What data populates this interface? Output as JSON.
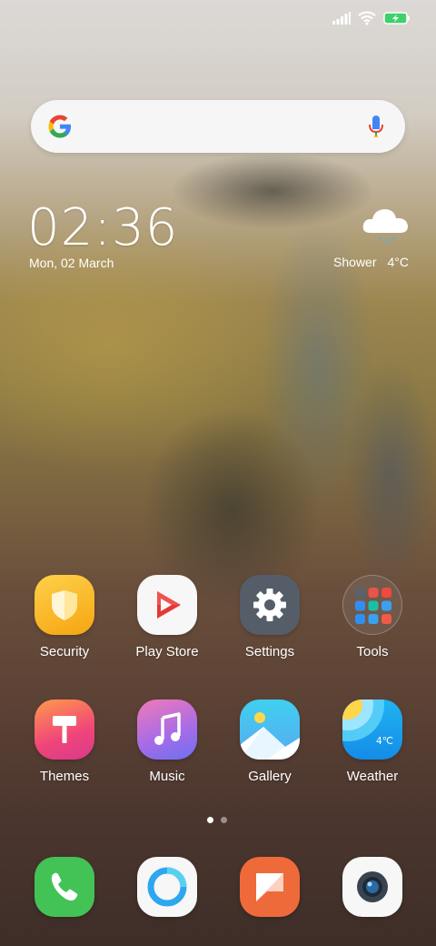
{
  "status_bar": {
    "icons": [
      "signal-icon",
      "wifi-icon",
      "battery-charging-icon"
    ]
  },
  "search": {
    "icon_left": "google-logo",
    "icon_right": "mic-icon",
    "placeholder": ""
  },
  "clock_widget": {
    "time": "02:36",
    "date": "Mon, 02 March"
  },
  "weather_widget": {
    "icon": "cloud-rain-icon",
    "condition": "Shower",
    "temperature": "4°C"
  },
  "apps_row1": [
    {
      "label": "Security",
      "icon": "shield-icon"
    },
    {
      "label": "Play Store",
      "icon": "play-store-icon"
    },
    {
      "label": "Settings",
      "icon": "gear-icon"
    },
    {
      "label": "Tools",
      "icon": "folder-icon"
    }
  ],
  "apps_row2": [
    {
      "label": "Themes",
      "icon": "paint-roller-icon"
    },
    {
      "label": "Music",
      "icon": "music-note-icon"
    },
    {
      "label": "Gallery",
      "icon": "gallery-icon"
    },
    {
      "label": "Weather",
      "icon": "weather-icon",
      "badge": "4℃"
    }
  ],
  "page_indicator": {
    "pages": 2,
    "current": 1
  },
  "dock": [
    {
      "icon": "phone-icon"
    },
    {
      "icon": "browser-icon"
    },
    {
      "icon": "messages-icon"
    },
    {
      "icon": "camera-icon"
    }
  ],
  "colors": {
    "security": "#f8b31a",
    "settings": "#555d69",
    "phone": "#43c256",
    "messages": "#ef6a3a",
    "accent_blue": "#2c9cf0"
  }
}
